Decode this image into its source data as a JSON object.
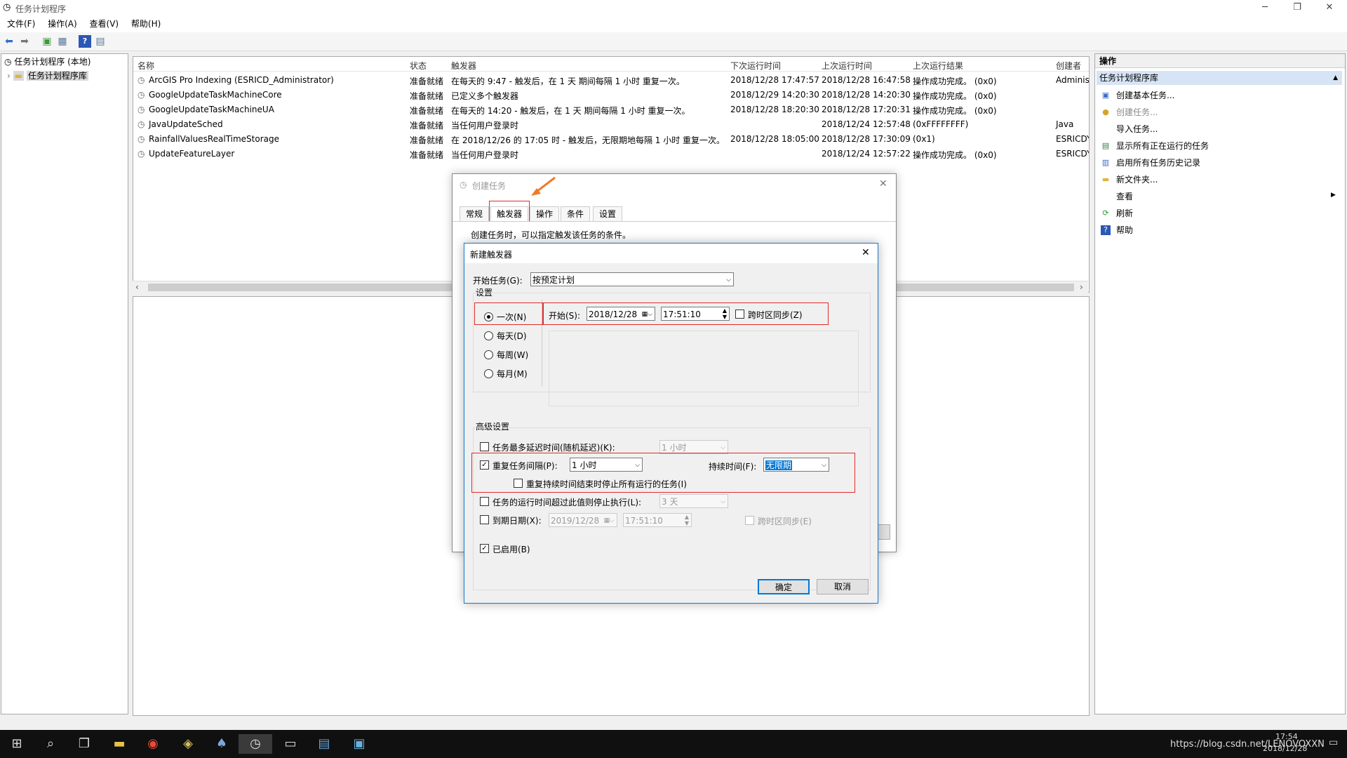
{
  "window": {
    "title": "任务计划程序"
  },
  "menu": [
    "文件(F)",
    "操作(A)",
    "查看(V)",
    "帮助(H)"
  ],
  "tree": {
    "root": "任务计划程序 (本地)",
    "child": "任务计划程序库"
  },
  "grid": {
    "headers": [
      "名称",
      "状态",
      "触发器",
      "下次运行时间",
      "上次运行时间",
      "上次运行结果",
      "创建者"
    ],
    "rows": [
      [
        "ArcGIS Pro Indexing (ESRICD_Administrator)",
        "准备就绪",
        "在每天的 9:47 - 触发后，在 1 天 期间每隔 1 小时 重复一次。",
        "2018/12/28 17:47:57",
        "2018/12/28 16:47:58",
        "操作成功完成。 (0x0)",
        "Adminis"
      ],
      [
        "GoogleUpdateTaskMachineCore",
        "准备就绪",
        "已定义多个触发器",
        "2018/12/29 14:20:30",
        "2018/12/28 14:20:30",
        "操作成功完成。 (0x0)",
        ""
      ],
      [
        "GoogleUpdateTaskMachineUA",
        "准备就绪",
        "在每天的 14:20 - 触发后，在 1 天 期间每隔 1 小时 重复一次。",
        "2018/12/28 18:20:30",
        "2018/12/28 17:20:31",
        "操作成功完成。 (0x0)",
        ""
      ],
      [
        "JavaUpdateSched",
        "准备就绪",
        "当任何用户登录时",
        "",
        "2018/12/24 12:57:48",
        "(0xFFFFFFFF)",
        "Java"
      ],
      [
        "RainfallValuesRealTimeStorage",
        "准备就绪",
        "在 2018/12/26 的 17:05 时 - 触发后，无限期地每隔 1 小时 重复一次。",
        "2018/12/28 18:05:00",
        "2018/12/28 17:30:09",
        "(0x1)",
        "ESRICDY"
      ],
      [
        "UpdateFeatureLayer",
        "准备就绪",
        "当任何用户登录时",
        "",
        "2018/12/24 12:57:22",
        "操作成功完成。 (0x0)",
        "ESRICDY"
      ]
    ]
  },
  "actions": {
    "header": "操作",
    "section": "任务计划程序库",
    "items": [
      "创建基本任务...",
      "创建任务...",
      "导入任务...",
      "显示所有正在运行的任务",
      "启用所有任务历史记录",
      "新文件夹...",
      "查看",
      "刷新",
      "帮助"
    ]
  },
  "create_dialog": {
    "title": "创建任务",
    "tabs": [
      "常规",
      "触发器",
      "操作",
      "条件",
      "设置"
    ],
    "description": "创建任务时，可以指定触发该任务的条件。"
  },
  "new_trigger": {
    "title": "新建触发器",
    "start_task_label": "开始任务(G):",
    "start_task_value": "按预定计划",
    "settings_label": "设置",
    "schedule_options": [
      "一次(N)",
      "每天(D)",
      "每周(W)",
      "每月(M)"
    ],
    "start_label": "开始(S):",
    "start_date": "2018/12/28",
    "start_time": "17:51:10",
    "sync_tz": "跨时区同步(Z)",
    "advanced_label": "高级设置",
    "delay_label": "任务最多延迟时间(随机延迟)(K):",
    "delay_value": "1 小时",
    "repeat_label": "重复任务间隔(P):",
    "repeat_value": "1 小时",
    "duration_label": "持续时间(F):",
    "duration_value": "无限期",
    "stop_all_label": "重复持续时间结束时停止所有运行的任务(I)",
    "stop_if_label": "任务的运行时间超过此值则停止执行(L):",
    "stop_if_value": "3 天",
    "expire_label": "到期日期(X):",
    "expire_date": "2019/12/28",
    "expire_time": "17:51:10",
    "expire_sync": "跨时区同步(E)",
    "enabled_label": "已启用(B)",
    "ok": "确定",
    "cancel": "取消"
  },
  "taskbar": {
    "url": "https://blog.csdn.net/LENOVOXXN",
    "time": "17:54",
    "date": "2018/12/28"
  },
  "colors": {
    "highlight": "#e12b2b",
    "accent": "#1979ca",
    "arrow": "#f07a26"
  }
}
